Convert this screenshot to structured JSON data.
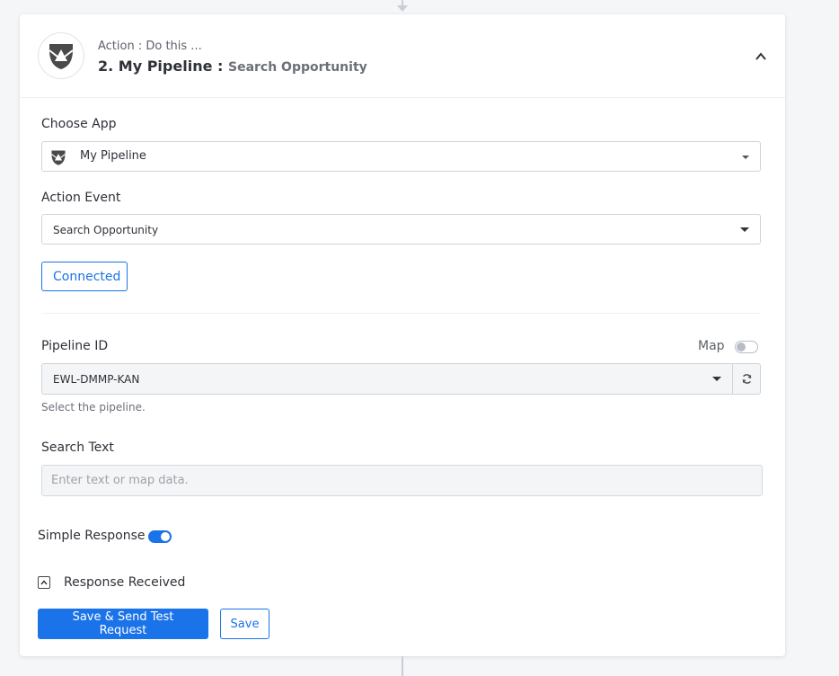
{
  "header": {
    "subtitle": "Action : Do this ...",
    "step_title": "2. My Pipeline :",
    "event_name": "Search Opportunity"
  },
  "choose_app": {
    "label": "Choose App",
    "value": "My Pipeline"
  },
  "action_event": {
    "label": "Action Event",
    "value": "Search Opportunity"
  },
  "connection": {
    "button_label": "Connected"
  },
  "pipeline_id": {
    "label": "Pipeline ID",
    "map_label": "Map",
    "map_enabled": false,
    "value": "EWL-DMMP-KAN",
    "help_text": "Select the pipeline."
  },
  "search_text": {
    "label": "Search Text",
    "placeholder": "Enter text or map data."
  },
  "simple_response": {
    "label": "Simple Response",
    "enabled": true
  },
  "response_received": {
    "label": "Response Received"
  },
  "actions": {
    "save_send_label": "Save & Send Test Request",
    "save_label": "Save"
  },
  "colors": {
    "accent": "#1a73e8",
    "background": "#f4f6f8",
    "card": "#ffffff"
  }
}
